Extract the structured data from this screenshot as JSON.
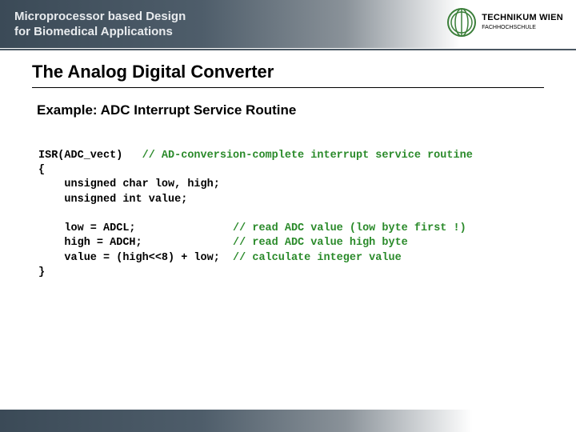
{
  "header": {
    "title_line1": "Microprocessor based Design",
    "title_line2": "for Biomedical Applications",
    "logo_line1": "TECHNIKUM",
    "logo_line2": "WIEN",
    "logo_small": "FACHHOCHSCHULE"
  },
  "slide": {
    "title": "The Analog Digital Converter",
    "example_heading": "Example: ADC Interrupt Service Routine"
  },
  "code": {
    "l1a": "ISR(ADC_vect)   ",
    "l1c": "// AD-conversion-complete interrupt service routine",
    "l2": "{",
    "l3": "    unsigned char low, high;",
    "l4": "    unsigned int value;",
    "blank": "",
    "l5a": "    low = ADCL;               ",
    "l5c": "// read ADC value (low byte first !)",
    "l6a": "    high = ADCH;              ",
    "l6c": "// read ADC value high byte",
    "l7a": "    value = (high<<8) + low;  ",
    "l7c": "// calculate integer value",
    "l8": "}"
  }
}
